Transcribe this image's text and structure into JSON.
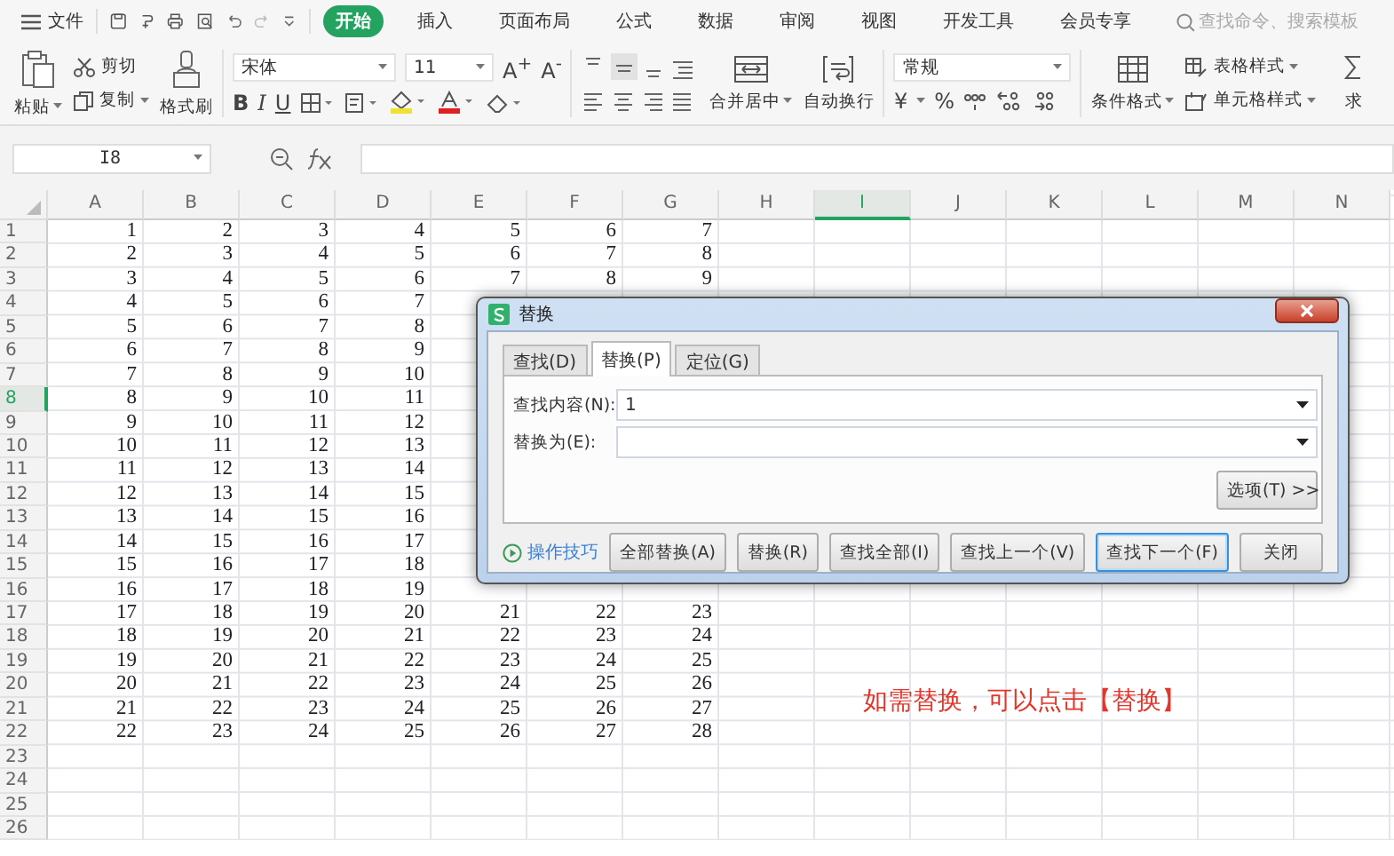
{
  "menu": {
    "file": "文件",
    "tabs": [
      {
        "label": "开始",
        "selected": true
      },
      {
        "label": "插入",
        "selected": false
      },
      {
        "label": "页面布局",
        "selected": false
      },
      {
        "label": "公式",
        "selected": false
      },
      {
        "label": "数据",
        "selected": false
      },
      {
        "label": "审阅",
        "selected": false
      },
      {
        "label": "视图",
        "selected": false
      },
      {
        "label": "开发工具",
        "selected": false
      },
      {
        "label": "会员专享",
        "selected": false
      }
    ],
    "search": {
      "placeholder": "查找命令、搜索模板"
    }
  },
  "ribbon": {
    "clipboard": {
      "paste": "粘贴",
      "cut": "剪切",
      "copy": "复制",
      "format_painter": "格式刷"
    },
    "font": {
      "name": "宋体",
      "size": "11",
      "grow": "A$^{+}$",
      "shrink": "A$^{-}$",
      "bold": "B",
      "italic": "I",
      "underline": "U"
    },
    "alignment": {
      "merge": "合并居中",
      "wrap": "自动换行"
    },
    "number": {
      "format": "常规",
      "currency": "¥",
      "percent": "%"
    },
    "styles": {
      "conditional": "条件格式",
      "table_style": "表格样式",
      "cell_style": "单元格样式",
      "sum": "求"
    }
  },
  "formula_bar": {
    "name_box": "I8"
  },
  "sheet": {
    "columns": [
      {
        "label": "A",
        "selected": false
      },
      {
        "label": "B",
        "selected": false
      },
      {
        "label": "C",
        "selected": false
      },
      {
        "label": "D",
        "selected": false
      },
      {
        "label": "E",
        "selected": false
      },
      {
        "label": "F",
        "selected": false
      },
      {
        "label": "G",
        "selected": false
      },
      {
        "label": "H",
        "selected": false
      },
      {
        "label": "I",
        "selected": true
      },
      {
        "label": "J",
        "selected": false
      },
      {
        "label": "K",
        "selected": false
      },
      {
        "label": "L",
        "selected": false
      },
      {
        "label": "M",
        "selected": false
      },
      {
        "label": "N",
        "selected": false
      }
    ],
    "rows": [
      {
        "label": "1",
        "selected": false,
        "cells": [
          "1",
          "2",
          "3",
          "4",
          "5",
          "6",
          "7"
        ]
      },
      {
        "label": "2",
        "selected": false,
        "cells": [
          "2",
          "3",
          "4",
          "5",
          "6",
          "7",
          "8"
        ]
      },
      {
        "label": "3",
        "selected": false,
        "cells": [
          "3",
          "4",
          "5",
          "6",
          "7",
          "8",
          "9"
        ]
      },
      {
        "label": "4",
        "selected": false,
        "cells": [
          "4",
          "5",
          "6",
          "7"
        ]
      },
      {
        "label": "5",
        "selected": false,
        "cells": [
          "5",
          "6",
          "7",
          "8"
        ]
      },
      {
        "label": "6",
        "selected": false,
        "cells": [
          "6",
          "7",
          "8",
          "9"
        ]
      },
      {
        "label": "7",
        "selected": false,
        "cells": [
          "7",
          "8",
          "9",
          "10"
        ]
      },
      {
        "label": "8",
        "selected": true,
        "cells": [
          "8",
          "9",
          "10",
          "11"
        ]
      },
      {
        "label": "9",
        "selected": false,
        "cells": [
          "9",
          "10",
          "11",
          "12"
        ]
      },
      {
        "label": "10",
        "selected": false,
        "cells": [
          "10",
          "11",
          "12",
          "13"
        ]
      },
      {
        "label": "11",
        "selected": false,
        "cells": [
          "11",
          "12",
          "13",
          "14"
        ]
      },
      {
        "label": "12",
        "selected": false,
        "cells": [
          "12",
          "13",
          "14",
          "15"
        ]
      },
      {
        "label": "13",
        "selected": false,
        "cells": [
          "13",
          "14",
          "15",
          "16"
        ]
      },
      {
        "label": "14",
        "selected": false,
        "cells": [
          "14",
          "15",
          "16",
          "17"
        ]
      },
      {
        "label": "15",
        "selected": false,
        "cells": [
          "15",
          "16",
          "17",
          "18"
        ]
      },
      {
        "label": "16",
        "selected": false,
        "cells": [
          "16",
          "17",
          "18",
          "19"
        ]
      },
      {
        "label": "17",
        "selected": false,
        "cells": [
          "17",
          "18",
          "19",
          "20",
          "21",
          "22",
          "23"
        ]
      },
      {
        "label": "18",
        "selected": false,
        "cells": [
          "18",
          "19",
          "20",
          "21",
          "22",
          "23",
          "24"
        ]
      },
      {
        "label": "19",
        "selected": false,
        "cells": [
          "19",
          "20",
          "21",
          "22",
          "23",
          "24",
          "25"
        ]
      },
      {
        "label": "20",
        "selected": false,
        "cells": [
          "20",
          "21",
          "22",
          "23",
          "24",
          "25",
          "26"
        ]
      },
      {
        "label": "21",
        "selected": false,
        "cells": [
          "21",
          "22",
          "23",
          "24",
          "25",
          "26",
          "27"
        ]
      },
      {
        "label": "22",
        "selected": false,
        "cells": [
          "22",
          "23",
          "24",
          "25",
          "26",
          "27",
          "28"
        ]
      },
      {
        "label": "23",
        "selected": false,
        "cells": []
      },
      {
        "label": "24",
        "selected": false,
        "cells": []
      },
      {
        "label": "25",
        "selected": false,
        "cells": []
      },
      {
        "label": "26",
        "selected": false,
        "cells": []
      }
    ]
  },
  "dialog": {
    "title": "替换",
    "tabs": [
      {
        "label": "查找(D)",
        "selected": false
      },
      {
        "label": "替换(P)",
        "selected": true
      },
      {
        "label": "定位(G)",
        "selected": false
      }
    ],
    "fields": [
      {
        "label": "查找内容(N):",
        "value": "1"
      },
      {
        "label": "替换为(E):"
      }
    ],
    "options_button": "选项(T) >>",
    "tips_link": "操作技巧",
    "buttons": [
      {
        "label": "全部替换(A)",
        "focused": false
      },
      {
        "label": "替换(R)",
        "focused": false
      },
      {
        "label": "查找全部(I)",
        "focused": false
      },
      {
        "label": "查找上一个(V)",
        "focused": false
      },
      {
        "label": "查找下一个(F)",
        "focused": true
      }
    ],
    "close_button": "关闭"
  },
  "annotation": "如需替换，可以点击【替换】"
}
